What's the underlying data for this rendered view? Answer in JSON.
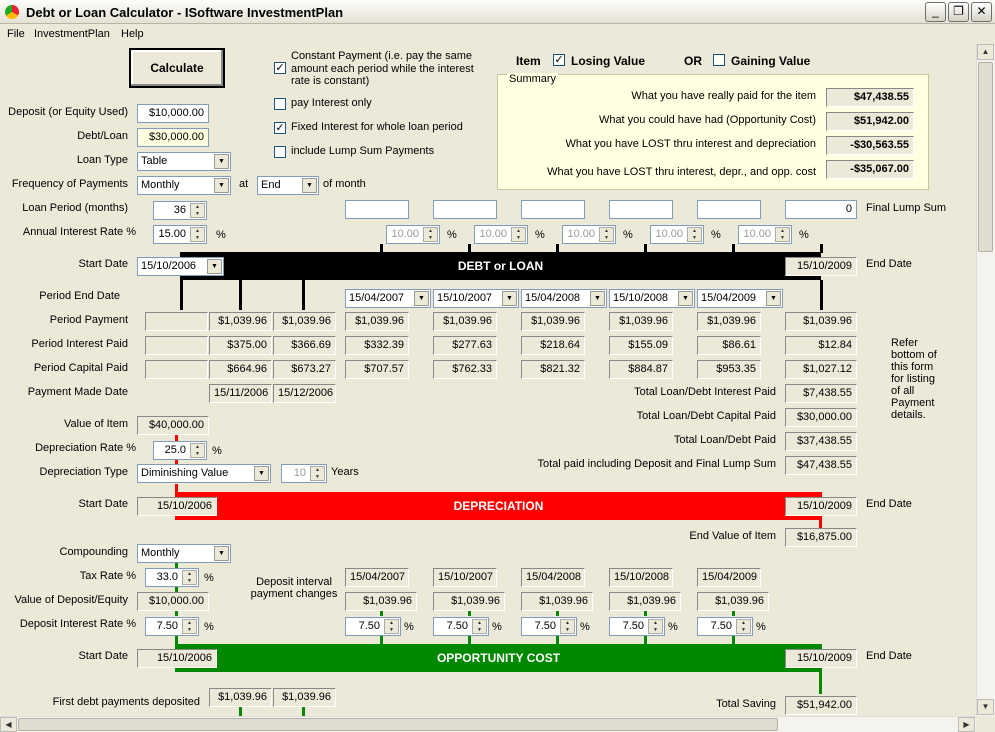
{
  "window": {
    "title": "Debt or Loan Calculator - ISoftware InvestmentPlan",
    "min": "_",
    "max": "❐",
    "close": "✕"
  },
  "menu": [
    "File",
    "InvestmentPlan",
    "Help"
  ],
  "calculate": "Calculate",
  "options": {
    "constant_payment": "Constant Payment (i.e. pay the same amount each period while the interest rate is constant)",
    "pay_interest_only": "pay Interest only",
    "fixed_interest": "Fixed Interest for whole loan period",
    "lump_sum": "include Lump Sum Payments"
  },
  "item": {
    "label": "Item",
    "losing": "Losing Value",
    "or": "OR",
    "gaining": "Gaining Value"
  },
  "summary": {
    "title": "Summary",
    "rows": [
      {
        "label": "What you have really paid for the item",
        "value": "$47,438.55"
      },
      {
        "label": "What you could have had (Opportunity Cost)",
        "value": "$51,942.00"
      },
      {
        "label": "What you have LOST thru interest and depreciation",
        "value": "-$30,563.55"
      },
      {
        "label": "What you have LOST thru interest, depr., and opp. cost",
        "value": "-$35,067.00"
      }
    ]
  },
  "loan": {
    "deposit_label": "Deposit (or Equity Used)",
    "deposit": "$10,000.00",
    "debt_label": "Debt/Loan",
    "debt": "$30,000.00",
    "type_label": "Loan Type",
    "type": "Table",
    "freq_label": "Frequency of Payments",
    "freq": "Monthly",
    "at": "at",
    "at_value": "End",
    "of_month": "of month",
    "period_label": "Loan Period (months)",
    "period": "36",
    "rate_label": "Annual Interest Rate %",
    "rate": "15.00",
    "pct": "%",
    "start_label": "Start Date",
    "start": "15/10/2006",
    "end_label": "End Date",
    "end": "15/10/2009",
    "bar": "DEBT or LOAN",
    "final_lump_label": "Final Lump Sum",
    "final_lump": "0",
    "future_rates": [
      "10.00",
      "10.00",
      "10.00",
      "10.00",
      "10.00"
    ]
  },
  "periods": {
    "end_label": "Period End Date",
    "end_dates": [
      "15/04/2007",
      "15/10/2007",
      "15/04/2008",
      "15/10/2008",
      "15/04/2009"
    ],
    "payment_label": "Period Payment",
    "interest_label": "Period Interest Paid",
    "capital_label": "Period Capital Paid",
    "made_label": "Payment Made Date",
    "first": {
      "payment": "$1,039.96",
      "interest": "$375.00",
      "capital": "$664.96",
      "made": "15/11/2006"
    },
    "second": {
      "payment": "$1,039.96",
      "interest": "$366.69",
      "capital": "$673.27",
      "made": "15/12/2006"
    },
    "cols": [
      {
        "payment": "$1,039.96",
        "interest": "$332.39",
        "capital": "$707.57"
      },
      {
        "payment": "$1,039.96",
        "interest": "$277.63",
        "capital": "$762.33"
      },
      {
        "payment": "$1,039.96",
        "interest": "$218.64",
        "capital": "$821.32"
      },
      {
        "payment": "$1,039.96",
        "interest": "$155.09",
        "capital": "$884.87"
      },
      {
        "payment": "$1,039.96",
        "interest": "$86.61",
        "capital": "$953.35"
      }
    ],
    "last": {
      "payment": "$1,039.96",
      "interest": "$12.84",
      "capital": "$1,027.12"
    }
  },
  "refer": [
    "Refer",
    "bottom of",
    "this form",
    "for listing",
    "of all",
    "Payment",
    "details."
  ],
  "totals": [
    {
      "label": "Total Loan/Debt Interest Paid",
      "value": "$7,438.55"
    },
    {
      "label": "Total Loan/Debt Capital Paid",
      "value": "$30,000.00"
    },
    {
      "label": "Total Loan/Debt Paid",
      "value": "$37,438.55"
    },
    {
      "label": "Total paid including Deposit and Final Lump Sum",
      "value": "$47,438.55"
    }
  ],
  "depreciation": {
    "value_label": "Value of Item",
    "value": "$40,000.00",
    "rate_label": "Depreciation Rate %",
    "rate": "25.0",
    "type_label": "Depreciation Type",
    "type": "Diminishing Value",
    "years": "10",
    "years_label": "Years",
    "start": "15/10/2006",
    "end": "15/10/2009",
    "bar": "DEPRECIATION",
    "end_value_label": "End Value of Item",
    "end_value": "$16,875.00"
  },
  "opportunity": {
    "compounding_label": "Compounding",
    "compounding": "Monthly",
    "tax_label": "Tax Rate %",
    "tax": "33.0",
    "dep_value_label": "Value of Deposit/Equity",
    "dep_value": "$10,000.00",
    "dep_rate_label": "Deposit Interest Rate %",
    "dep_rate": "7.50",
    "interval_label": "Deposit interval payment changes",
    "dates": [
      "15/04/2007",
      "15/10/2007",
      "15/04/2008",
      "15/10/2008",
      "15/04/2009"
    ],
    "payments": [
      "$1,039.96",
      "$1,039.96",
      "$1,039.96",
      "$1,039.96",
      "$1,039.96"
    ],
    "rates": [
      "7.50",
      "7.50",
      "7.50",
      "7.50",
      "7.50"
    ],
    "start": "15/10/2006",
    "end": "15/10/2009",
    "bar": "OPPORTUNITY COST",
    "first_label": "First debt payments deposited",
    "first_payments": [
      "$1,039.96",
      "$1,039.96"
    ],
    "total_label": "Total Saving",
    "total": "$51,942.00"
  },
  "colors": {
    "debt": "#000000",
    "depreciation": "#ff0000",
    "opportunity": "#008000"
  }
}
